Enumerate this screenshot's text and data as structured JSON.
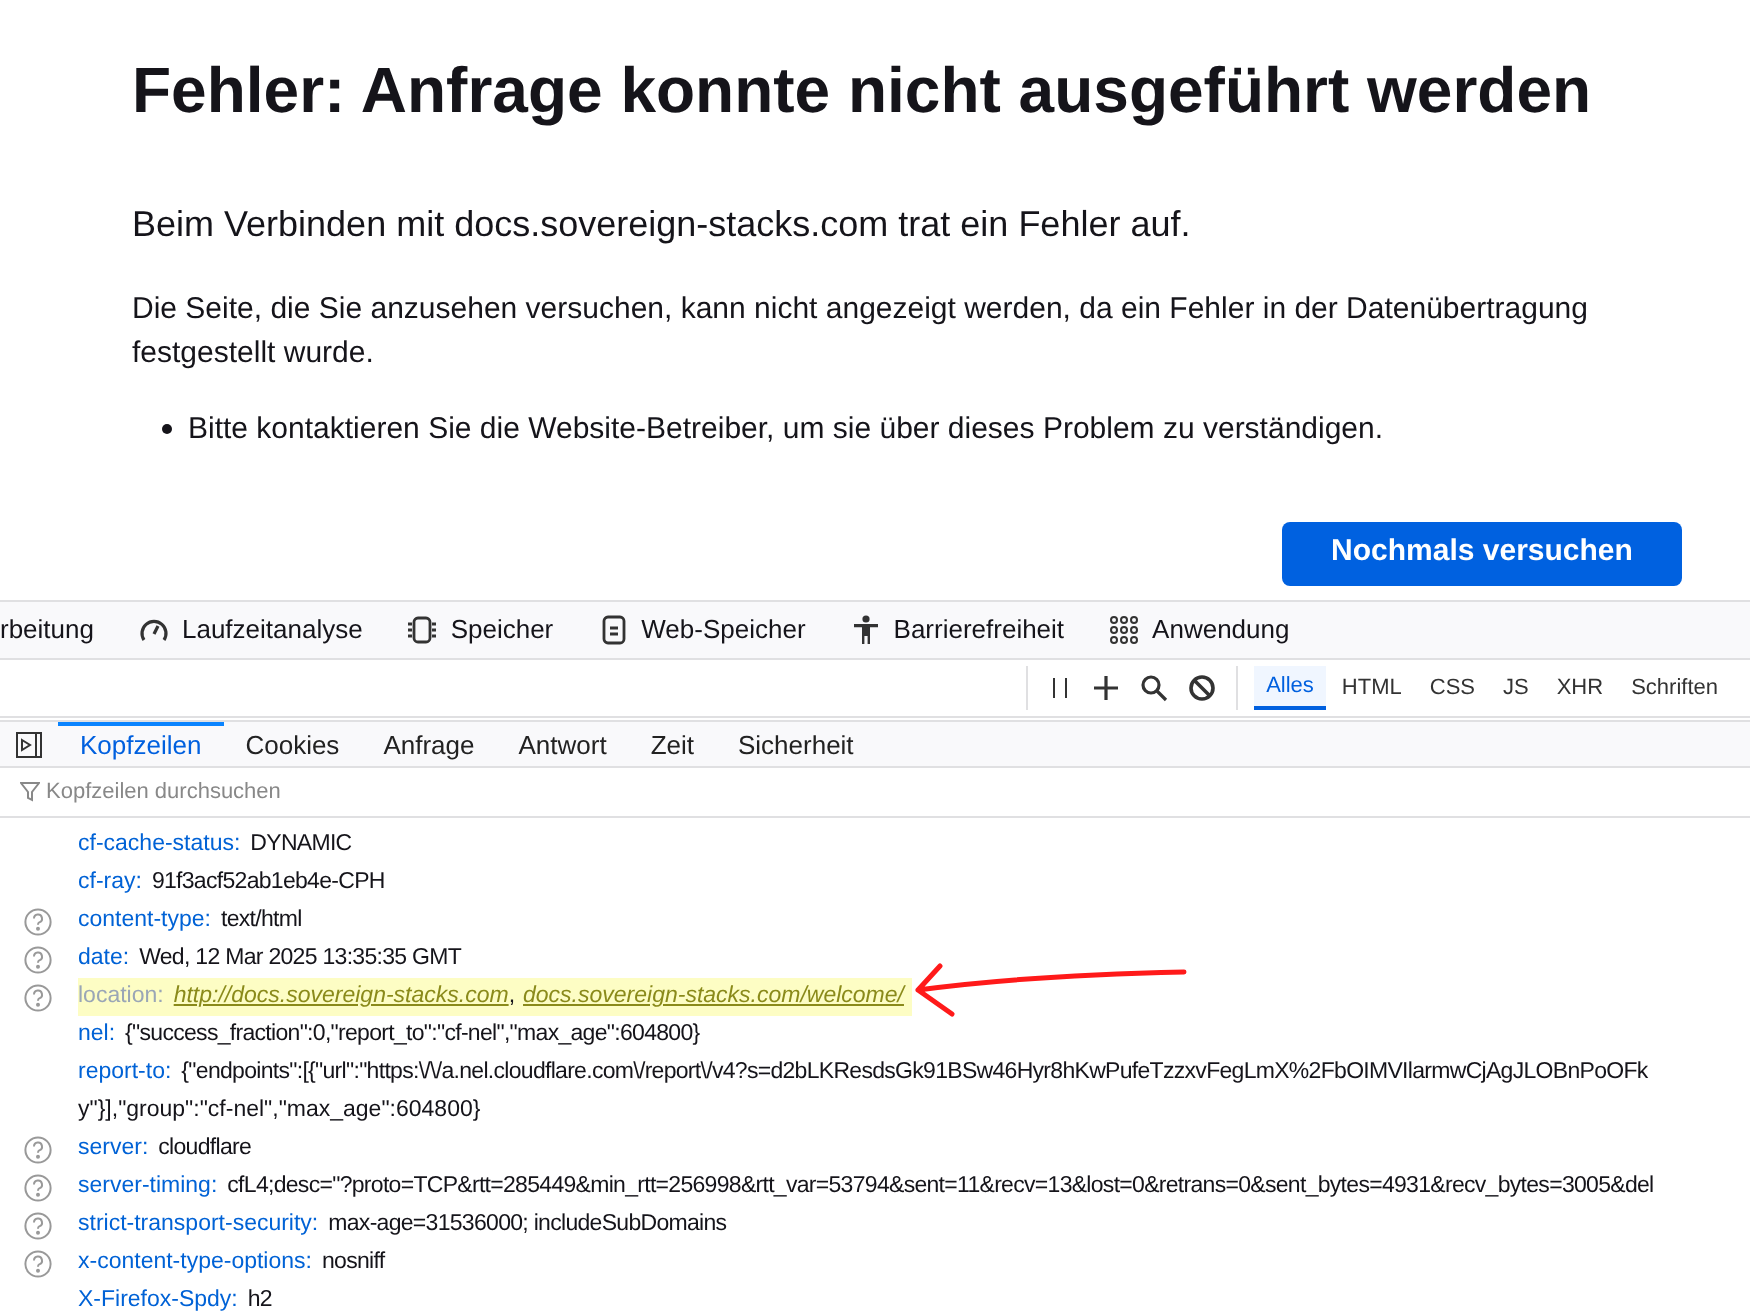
{
  "error_page": {
    "title": "Fehler: Anfrage konnte nicht ausgeführt werden",
    "lead": "Beim Verbinden mit docs.sovereign-stacks.com trat ein Fehler auf.",
    "description": "Die Seite, die Sie anzusehen versuchen, kann nicht angezeigt werden, da ein Fehler in der Datenübertragung festgestellt wurde.",
    "bullets": [
      "Bitte kontaktieren Sie die Website-Betreiber, um sie über dieses Problem zu verständigen."
    ],
    "retry_button": "Nochmals versuchen"
  },
  "devtools_tabs": [
    {
      "label": "rbeitung",
      "kind": "plain"
    },
    {
      "label": "Laufzeitanalyse",
      "kind": "performance"
    },
    {
      "label": "Speicher",
      "kind": "memory"
    },
    {
      "label": "Web-Speicher",
      "kind": "storage"
    },
    {
      "label": "Barrierefreiheit",
      "kind": "accessibility"
    },
    {
      "label": "Anwendung",
      "kind": "application"
    }
  ],
  "type_filters": [
    {
      "label": "Alles",
      "selected": true
    },
    {
      "label": "HTML",
      "selected": false
    },
    {
      "label": "CSS",
      "selected": false
    },
    {
      "label": "JS",
      "selected": false
    },
    {
      "label": "XHR",
      "selected": false
    },
    {
      "label": "Schriften",
      "selected": false
    }
  ],
  "detail_tabs": [
    {
      "label": "Kopfzeilen",
      "selected": true
    },
    {
      "label": "Cookies",
      "selected": false
    },
    {
      "label": "Anfrage",
      "selected": false
    },
    {
      "label": "Antwort",
      "selected": false
    },
    {
      "label": "Zeit",
      "selected": false
    },
    {
      "label": "Sicherheit",
      "selected": false
    }
  ],
  "filter": {
    "placeholder": "Kopfzeilen durchsuchen"
  },
  "headers": [
    {
      "name": "cf-cache-status:",
      "value": "DYNAMIC",
      "help": false,
      "highlighted": false
    },
    {
      "name": "cf-ray:",
      "value": "91f3acf52ab1eb4e-CPH",
      "help": false,
      "highlighted": false
    },
    {
      "name": "content-type:",
      "value": "text/html",
      "help": true,
      "highlighted": false
    },
    {
      "name": "date:",
      "value": "Wed, 12 Mar 2025 13:35:35 GMT",
      "help": true,
      "highlighted": false
    },
    {
      "name": "location:",
      "links": [
        "http://docs.sovereign-stacks.com",
        "docs.sovereign-stacks.com/welcome/"
      ],
      "separator": ",",
      "help": true,
      "highlighted": true
    },
    {
      "name": "nel:",
      "value": "{\"success_fraction\":0,\"report_to\":\"cf-nel\",\"max_age\":604800}",
      "help": false,
      "highlighted": false
    },
    {
      "name": "report-to:",
      "value": "{\"endpoints\":[{\"url\":\"https:\\/\\/a.nel.cloudflare.com\\/report\\/v4?s=d2bLKResdsGk91BSw46Hyr8hKwPufeTzzxvFegLmX%2FbOIMVIlarmwCjAgJLOBnPoOFk",
      "value_2": "y\"}],\"group\":\"cf-nel\",\"max_age\":604800}",
      "help": false,
      "highlighted": false
    },
    {
      "name": "server:",
      "value": "cloudflare",
      "help": true,
      "highlighted": false
    },
    {
      "name": "server-timing:",
      "value": "cfL4;desc=\"?proto=TCP&rtt=285449&min_rtt=256998&rtt_var=53794&sent=11&recv=13&lost=0&retrans=0&sent_bytes=4931&recv_bytes=3005&del",
      "help": true,
      "highlighted": false
    },
    {
      "name": "strict-transport-security:",
      "value": "max-age=31536000; includeSubDomains",
      "help": true,
      "highlighted": false
    },
    {
      "name": "x-content-type-options:",
      "value": "nosniff",
      "help": true,
      "highlighted": false
    },
    {
      "name": "X-Firefox-Spdy:",
      "value": "h2",
      "help": false,
      "highlighted": false
    }
  ]
}
